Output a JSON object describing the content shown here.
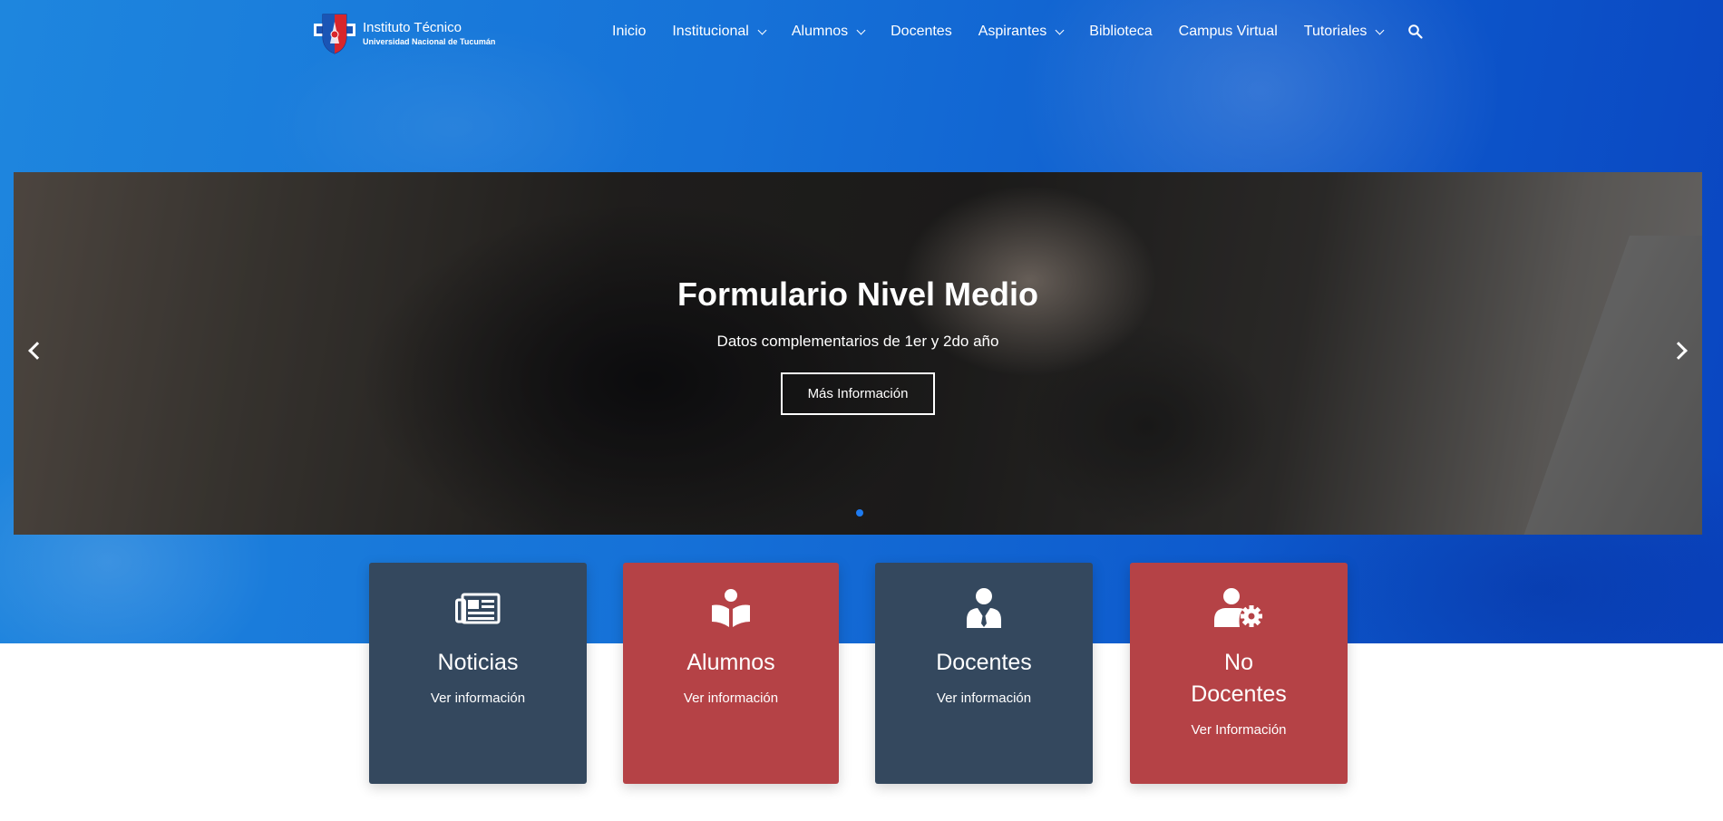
{
  "brand": {
    "title": "Instituto Técnico",
    "subtitle": "Universidad Nacional de Tucumán"
  },
  "nav": {
    "items": [
      {
        "label": "Inicio",
        "dropdown": false
      },
      {
        "label": "Institucional",
        "dropdown": true
      },
      {
        "label": "Alumnos",
        "dropdown": true
      },
      {
        "label": "Docentes",
        "dropdown": false
      },
      {
        "label": "Aspirantes",
        "dropdown": true
      },
      {
        "label": "Biblioteca",
        "dropdown": false
      },
      {
        "label": "Campus Virtual",
        "dropdown": false
      },
      {
        "label": "Tutoriales",
        "dropdown": true
      }
    ],
    "search_icon": "search-icon"
  },
  "slider": {
    "title": "Formulario Nivel Medio",
    "subtitle": "Datos complementarios de 1er y 2do año",
    "button": "Más Información",
    "active_slide": 1,
    "slide_count": 1
  },
  "cards": [
    {
      "title": "Noticias",
      "link": "Ver información",
      "icon": "newspaper-icon",
      "color": "#34485e"
    },
    {
      "title": "Alumnos",
      "link": "Ver información",
      "icon": "book-reader-icon",
      "color": "#b54246"
    },
    {
      "title": "Docentes",
      "link": "Ver información",
      "icon": "user-tie-icon",
      "color": "#34485e"
    },
    {
      "title_line1": "No",
      "title_line2": "Docentes",
      "link": "Ver Información",
      "icon": "user-cog-icon",
      "color": "#b54246"
    }
  ],
  "colors": {
    "hero_blue": "#1672d8",
    "card_dark": "#34485e",
    "card_red": "#b54246",
    "slider_dot": "#1e7bf0"
  }
}
